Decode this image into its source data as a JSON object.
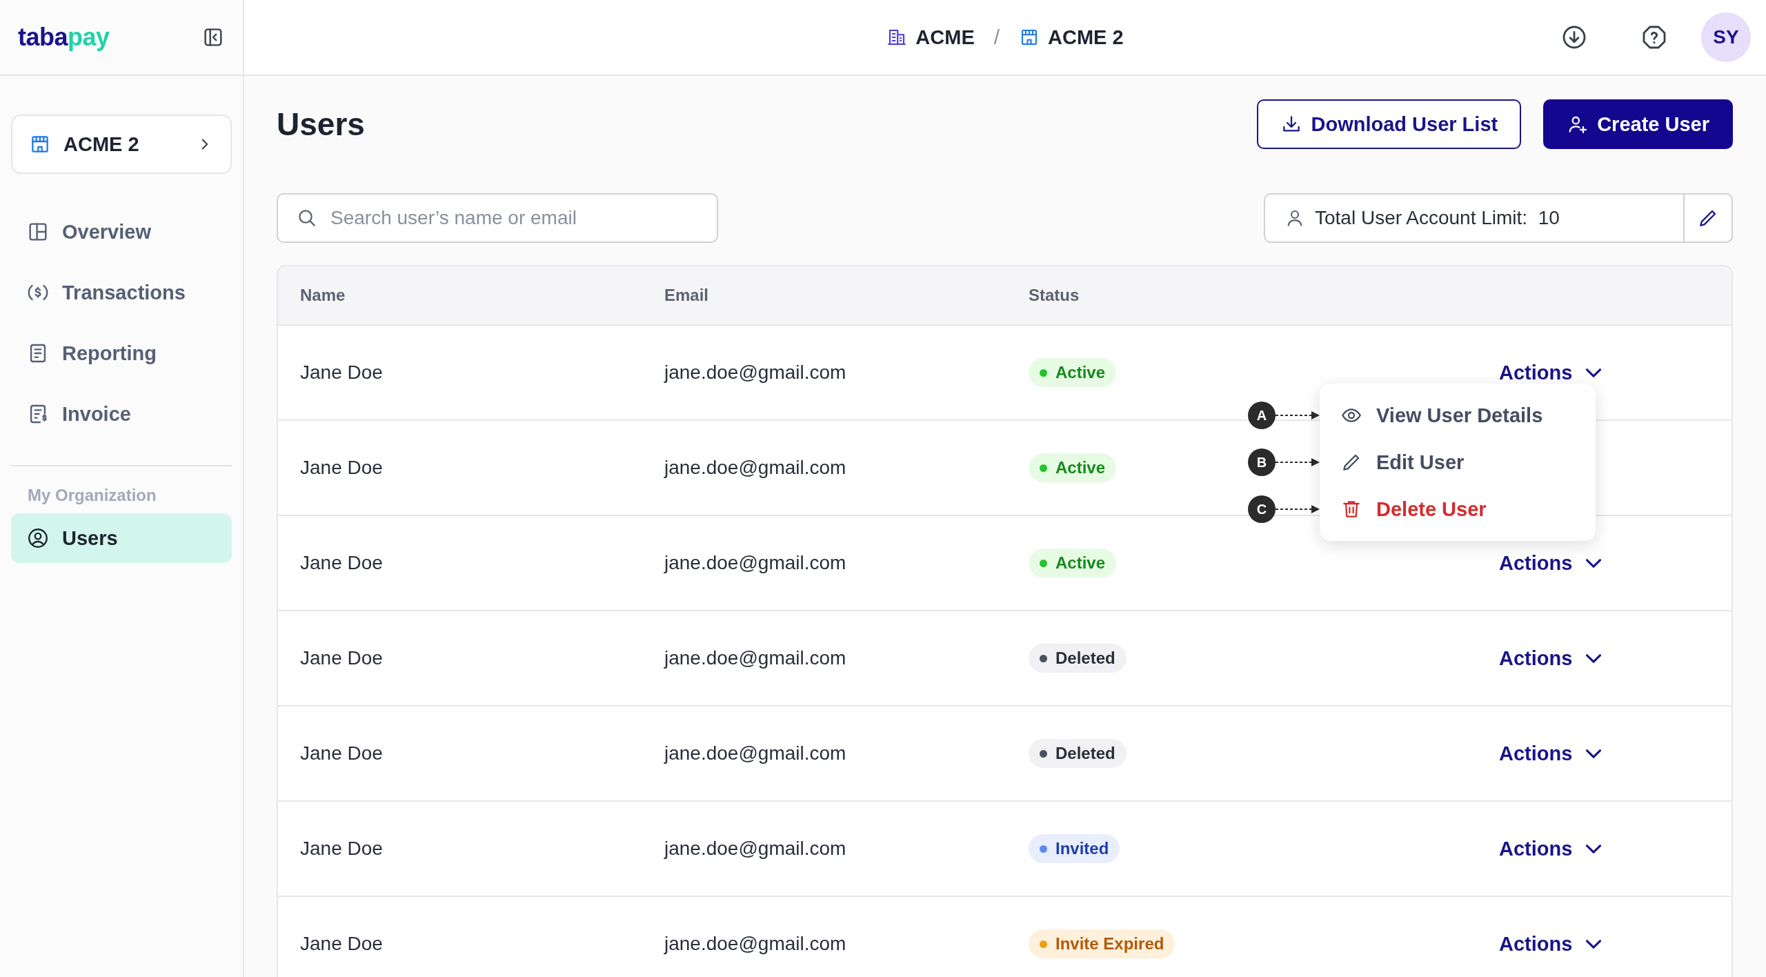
{
  "logo": {
    "dark": "taba",
    "accent": "pay"
  },
  "sidebar": {
    "org_selector": "ACME 2",
    "items": [
      {
        "label": "Overview",
        "kind": "overview",
        "selected": false
      },
      {
        "label": "Transactions",
        "kind": "transactions",
        "selected": false
      },
      {
        "label": "Reporting",
        "kind": "reporting",
        "selected": false
      },
      {
        "label": "Invoice",
        "kind": "invoice",
        "selected": false
      }
    ],
    "section_title": "My Organization",
    "section_items": [
      {
        "label": "Users",
        "kind": "users",
        "selected": true
      }
    ]
  },
  "breadcrumb": {
    "items": [
      {
        "label": "ACME",
        "kind": "company"
      },
      {
        "label": "ACME 2",
        "kind": "store"
      }
    ],
    "separator": "/"
  },
  "avatar": "SY",
  "page": {
    "title": "Users",
    "buttons": [
      {
        "label": "Download User List",
        "kind": "secondary"
      },
      {
        "label": "Create User",
        "kind": "primary"
      }
    ],
    "search": {
      "placeholder": "Search user’s name or email"
    },
    "limit": {
      "label": "Total User Account Limit:",
      "value": "10"
    }
  },
  "table": {
    "columns": [
      "Name",
      "Email",
      "Status"
    ],
    "rows": [
      {
        "name": "Jane Doe",
        "email": "jane.doe@gmail.com",
        "status": {
          "label": "Active",
          "kind": "active"
        },
        "actions": "Actions"
      },
      {
        "name": "Jane Doe",
        "email": "jane.doe@gmail.com",
        "status": {
          "label": "Active",
          "kind": "active"
        }
      },
      {
        "name": "Jane Doe",
        "email": "jane.doe@gmail.com",
        "status": {
          "label": "Active",
          "kind": "active"
        },
        "actions": "Actions"
      },
      {
        "name": "Jane Doe",
        "email": "jane.doe@gmail.com",
        "status": {
          "label": "Deleted",
          "kind": "deleted"
        },
        "actions": "Actions"
      },
      {
        "name": "Jane Doe",
        "email": "jane.doe@gmail.com",
        "status": {
          "label": "Deleted",
          "kind": "deleted"
        },
        "actions": "Actions"
      },
      {
        "name": "Jane Doe",
        "email": "jane.doe@gmail.com",
        "status": {
          "label": "Invited",
          "kind": "invited"
        },
        "actions": "Actions"
      },
      {
        "name": "Jane Doe",
        "email": "jane.doe@gmail.com",
        "status": {
          "label": "Invite Expired",
          "kind": "expired"
        },
        "actions": "Actions"
      }
    ]
  },
  "menu": {
    "items": [
      {
        "label": "View User Details",
        "kind": "view",
        "marker": "A"
      },
      {
        "label": "Edit User",
        "kind": "edit",
        "marker": "B"
      },
      {
        "label": "Delete User",
        "kind": "delete",
        "marker": "C"
      }
    ]
  }
}
